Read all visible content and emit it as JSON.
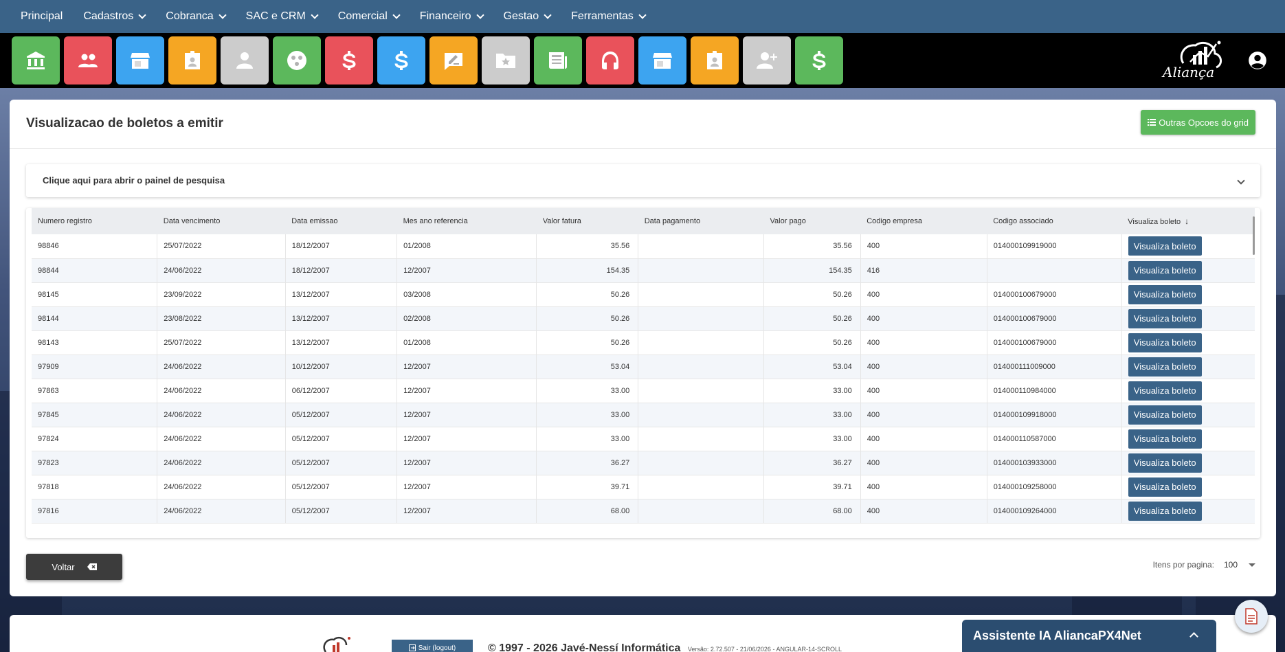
{
  "menu": {
    "items": [
      {
        "label": "Principal",
        "dropdown": false
      },
      {
        "label": "Cadastros",
        "dropdown": true
      },
      {
        "label": "Cobranca",
        "dropdown": true
      },
      {
        "label": "SAC e CRM",
        "dropdown": true
      },
      {
        "label": "Comercial",
        "dropdown": true
      },
      {
        "label": "Financeiro",
        "dropdown": true
      },
      {
        "label": "Gestao",
        "dropdown": true
      },
      {
        "label": "Ferramentas",
        "dropdown": true
      }
    ]
  },
  "toolbar": {
    "tiles": [
      {
        "icon": "bank-icon",
        "color": "#5cb85c"
      },
      {
        "icon": "people-icon",
        "color": "#e9525b"
      },
      {
        "icon": "store-icon",
        "color": "#3da4f0"
      },
      {
        "icon": "badge-icon",
        "color": "#f5a623"
      },
      {
        "icon": "person-icon",
        "color": "#cccccc"
      },
      {
        "icon": "dots-circle-icon",
        "color": "#5cb85c"
      },
      {
        "icon": "dollar-icon",
        "color": "#e9525b"
      },
      {
        "icon": "dollar-icon",
        "color": "#3da4f0"
      },
      {
        "icon": "edit-note-icon",
        "color": "#f5a623"
      },
      {
        "icon": "folder-star-icon",
        "color": "#cccccc"
      },
      {
        "icon": "newspaper-icon",
        "color": "#5cb85c"
      },
      {
        "icon": "headset-icon",
        "color": "#e9525b"
      },
      {
        "icon": "store-icon",
        "color": "#3da4f0"
      },
      {
        "icon": "badge-icon",
        "color": "#f5a623"
      },
      {
        "icon": "person-add-icon",
        "color": "#cccccc"
      },
      {
        "icon": "dollar-icon",
        "color": "#5cb85c"
      }
    ]
  },
  "page": {
    "title": "Visualizacao de boletos a emitir",
    "grid_options_label": "Outras Opcoes do grid",
    "search_panel_label": "Clique aqui para abrir o painel de pesquisa"
  },
  "table": {
    "columns": [
      "Numero registro",
      "Data vencimento",
      "Data emissao",
      "Mes ano referencia",
      "Valor fatura",
      "Data pagamento",
      "Valor pago",
      "Codigo empresa",
      "Codigo associado",
      "Visualiza boleto"
    ],
    "button_label": "Visualiza boleto",
    "rows": [
      [
        "98846",
        "25/07/2022",
        "18/12/2007",
        "01/2008",
        "35.56",
        "",
        "35.56",
        "400",
        "014000109919000"
      ],
      [
        "98844",
        "24/06/2022",
        "18/12/2007",
        "12/2007",
        "154.35",
        "",
        "154.35",
        "416",
        ""
      ],
      [
        "98145",
        "23/09/2022",
        "13/12/2007",
        "03/2008",
        "50.26",
        "",
        "50.26",
        "400",
        "014000100679000"
      ],
      [
        "98144",
        "23/08/2022",
        "13/12/2007",
        "02/2008",
        "50.26",
        "",
        "50.26",
        "400",
        "014000100679000"
      ],
      [
        "98143",
        "25/07/2022",
        "13/12/2007",
        "01/2008",
        "50.26",
        "",
        "50.26",
        "400",
        "014000100679000"
      ],
      [
        "97909",
        "24/06/2022",
        "10/12/2007",
        "12/2007",
        "53.04",
        "",
        "53.04",
        "400",
        "014000111009000"
      ],
      [
        "97863",
        "24/06/2022",
        "06/12/2007",
        "12/2007",
        "33.00",
        "",
        "33.00",
        "400",
        "014000110984000"
      ],
      [
        "97845",
        "24/06/2022",
        "05/12/2007",
        "12/2007",
        "33.00",
        "",
        "33.00",
        "400",
        "014000109918000"
      ],
      [
        "97824",
        "24/06/2022",
        "05/12/2007",
        "12/2007",
        "33.00",
        "",
        "33.00",
        "400",
        "014000110587000"
      ],
      [
        "97823",
        "24/06/2022",
        "05/12/2007",
        "12/2007",
        "36.27",
        "",
        "36.27",
        "400",
        "014000103933000"
      ],
      [
        "97818",
        "24/06/2022",
        "05/12/2007",
        "12/2007",
        "39.71",
        "",
        "39.71",
        "400",
        "014000109258000"
      ],
      [
        "97816",
        "24/06/2022",
        "05/12/2007",
        "12/2007",
        "68.00",
        "",
        "68.00",
        "400",
        "014000109264000"
      ]
    ]
  },
  "actions": {
    "back_label": "Voltar"
  },
  "pagination": {
    "items_label": "Itens por pagina:",
    "items_value": "100"
  },
  "footer": {
    "logout_label": "Sair (logout)",
    "copyright": "© 1997 - 2026 Javé-Nessí Informática",
    "version": "Versão: 2.72.507 - 21/06/2026 - ANGULAR-14-SCROLL"
  },
  "assistant": {
    "label": "Assistente IA AliancaPX4Net"
  },
  "colors": {
    "menu_bg": "#3a6388",
    "primary_button": "#3a6388",
    "grid_options_bg": "#5cb85c"
  }
}
